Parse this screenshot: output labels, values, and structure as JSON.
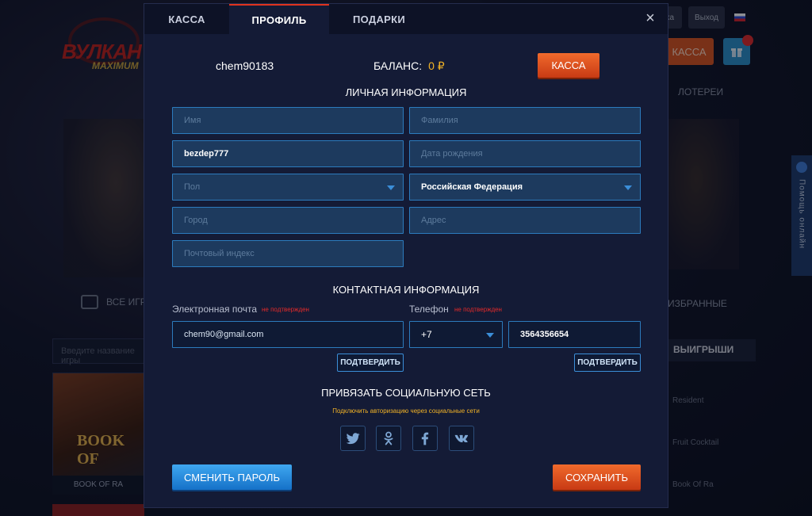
{
  "background": {
    "logo_text": "ВУЛКАН",
    "logo_subtext": "MAXIMUM",
    "login_label": "…ка",
    "exit_label": "Выход",
    "kassa_label": "КАССА",
    "lottery_label": "ЛОТЕРЕИ",
    "all_games_label": "ВСЕ ИГРЫ",
    "favorites_label": "ИЗБРАННЫЕ",
    "search_placeholder": "Введите название игры",
    "winners_title": "ВЫИГРЫШИ",
    "winner_items": [
      "Resident",
      "Fruit Cocktail",
      "Book Of Ra"
    ],
    "game_title": "BOOK OF",
    "game_label": "BOOK OF RA",
    "help_label": "Помощь онлайн"
  },
  "modal": {
    "tabs": [
      "КАССА",
      "ПРОФИЛЬ",
      "ПОДАРКИ"
    ],
    "active_tab": "ПРОФИЛЬ",
    "close_icon": "×",
    "username": "chem90183",
    "balance_label": "БАЛАНС:",
    "balance_value": "0 ₽",
    "kassa_button": "КАССА",
    "personal_title": "ЛИЧНАЯ ИНФОРМАЦИЯ",
    "fields": {
      "first_name": "Имя",
      "last_name": "Фамилия",
      "nickname_value": "bezdep777",
      "birthdate": "Дата рождения",
      "gender": "Пол",
      "country_value": "Российская Федерация",
      "city": "Город",
      "address": "Адрес",
      "postal": "Почтовый индекс"
    },
    "contact_title": "КОНТАКТНАЯ ИНФОРМАЦИЯ",
    "email_label": "Электронная почта",
    "email_status": "не подтвержден",
    "email_value": "chem90@gmail.com",
    "phone_label": "Телефон",
    "phone_status": "не подтвержден",
    "phone_code": "+7",
    "phone_value": "3564356654",
    "confirm_email_button": "ПОДТВЕРДИТЬ",
    "confirm_phone_button": "ПОДТВЕРДИТЬ",
    "social_title": "ПРИВЯЗАТЬ СОЦИАЛЬНУЮ СЕТЬ",
    "social_hint": "Подключить авторизацию через социальные сети",
    "social_icons": [
      "twitter-icon",
      "odnoklassniki-icon",
      "facebook-icon",
      "vk-icon"
    ],
    "change_password_button": "СМЕНИТЬ ПАРОЛЬ",
    "save_button": "СОХРАНИТЬ"
  },
  "colors": {
    "accent_orange": "#e0331e",
    "balance_gold": "#f2b326",
    "field_border": "#2c7bbd",
    "warning_red": "#e22a2a"
  }
}
